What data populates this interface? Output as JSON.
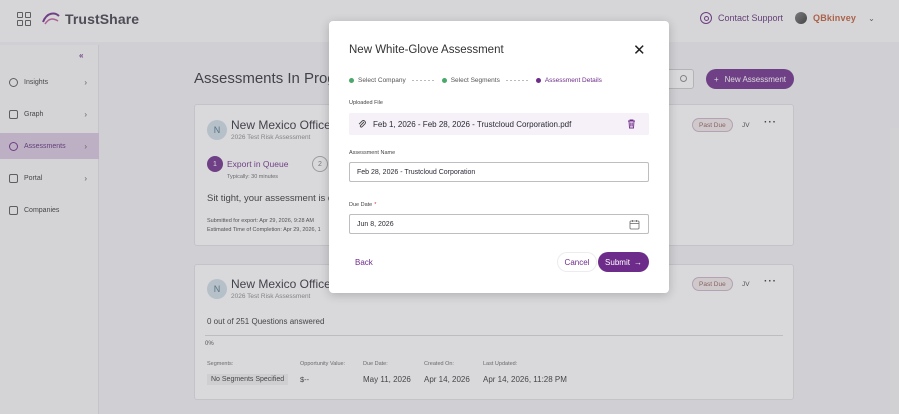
{
  "app": {
    "name": "TrustShare"
  },
  "topbar": {
    "contact_label": "Contact Support",
    "brand_label": "QBkinvey"
  },
  "sidebar": {
    "items": [
      {
        "label": "Insights",
        "icon": "bulb-icon"
      },
      {
        "label": "Graph",
        "icon": "chart-icon"
      },
      {
        "label": "Assessments",
        "icon": "assessment-icon",
        "active": true
      },
      {
        "label": "Portal",
        "icon": "portal-icon"
      },
      {
        "label": "Companies",
        "icon": "building-icon"
      }
    ]
  },
  "main": {
    "title": "Assessments In Progre",
    "new_button": "New Assessment",
    "cards": [
      {
        "avatar": "N",
        "title": "New Mexico Office o",
        "subtitle": "2026 Test Risk Assessment",
        "badge": "Past Due",
        "initials": "JV",
        "step1_num": "1",
        "step1_label": "Export in Queue",
        "step1_sub": "Typically: 30 minutes",
        "step2_num": "2",
        "message": "Sit tight, your assessment is qu",
        "submitted": "Submitted for export: Apr 29, 2026, 9:28 AM",
        "estimated": "Estimated Time of Completion: Apr 29, 2026, 1"
      },
      {
        "avatar": "N",
        "title": "New Mexico Office o",
        "subtitle": "2026 Test Risk Assessment",
        "badge": "Past Due",
        "initials": "JV",
        "answered": "0 out of 251 Questions answered",
        "percent": "0%",
        "segments_label": "Segments:",
        "segments_value": "No Segments Specified",
        "opportunity_label": "Opportunity Value:",
        "opportunity_value": "$--",
        "due_label": "Due Date:",
        "due_value": "May 11, 2026",
        "created_label": "Created On:",
        "created_value": "Apr 14, 2026",
        "updated_label": "Last Updated:",
        "updated_value": "Apr 14, 2026, 11:28 PM"
      }
    ]
  },
  "modal": {
    "title": "New White-Glove Assessment",
    "steps": [
      {
        "label": "Select Company",
        "state": "done"
      },
      {
        "label": "Select Segments",
        "state": "done"
      },
      {
        "label": "Assessment Details",
        "state": "active"
      }
    ],
    "uploaded_file_label": "Uploaded File",
    "file_name": "Feb 1, 2026 - Feb 28, 2026 - Trustcloud Corporation.pdf",
    "name_label": "Assessment Name",
    "name_value": "Feb 28, 2026 - Trustcloud Corporation",
    "due_label": "Due Date",
    "due_required": "*",
    "due_value": "Jun 8, 2026",
    "back": "Back",
    "cancel": "Cancel",
    "submit": "Submit"
  },
  "colors": {
    "accent": "#6e2c8a",
    "success": "#4aa86a",
    "required": "#c03c3c"
  }
}
